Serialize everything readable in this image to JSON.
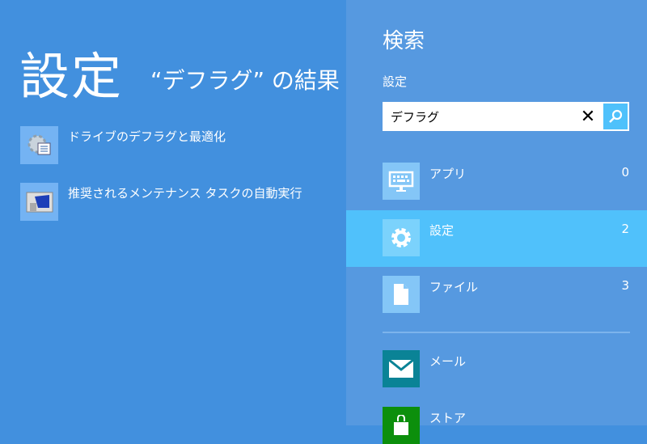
{
  "results_panel": {
    "title": "設定",
    "subtitle": "“デフラグ” の結果",
    "items": [
      {
        "label": "ドライブのデフラグと最適化",
        "icon": "defrag-gear-icon"
      },
      {
        "label": "推奨されるメンテナンス タスクの自動実行",
        "icon": "maintenance-icon"
      }
    ]
  },
  "search_pane": {
    "title": "検索",
    "scope": "設定",
    "query": "デフラグ",
    "clear_icon": "✕",
    "categories": [
      {
        "label": "アプリ",
        "count": "0",
        "icon": "keyboard-icon"
      },
      {
        "label": "設定",
        "count": "2",
        "icon": "gear-icon",
        "selected": true
      },
      {
        "label": "ファイル",
        "count": "3",
        "icon": "file-icon"
      }
    ],
    "apps": [
      {
        "label": "メール",
        "color": "#0a8396",
        "icon": "mail-icon"
      },
      {
        "label": "ストア",
        "color": "#0c8f0c",
        "icon": "store-icon"
      }
    ]
  }
}
